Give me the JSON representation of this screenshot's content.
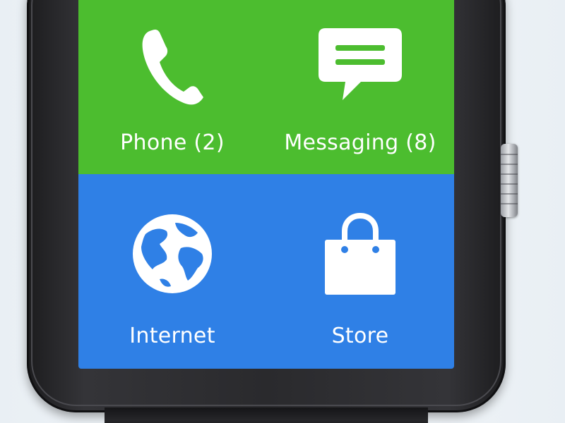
{
  "colors": {
    "phone_tile": "#4cbd2f",
    "internet_tile": "#2f80e6",
    "icon_fill": "#ffffff",
    "bezel": "#2a2a2d",
    "crown": "#c8cace"
  },
  "apps": {
    "phone": {
      "label": "Phone (2)",
      "icon": "phone-icon"
    },
    "messaging": {
      "label": "Messaging (8)",
      "icon": "chat-bubble-icon"
    },
    "internet": {
      "label": "Internet",
      "icon": "globe-icon"
    },
    "store": {
      "label": "Store",
      "icon": "shopping-bag-icon"
    }
  }
}
